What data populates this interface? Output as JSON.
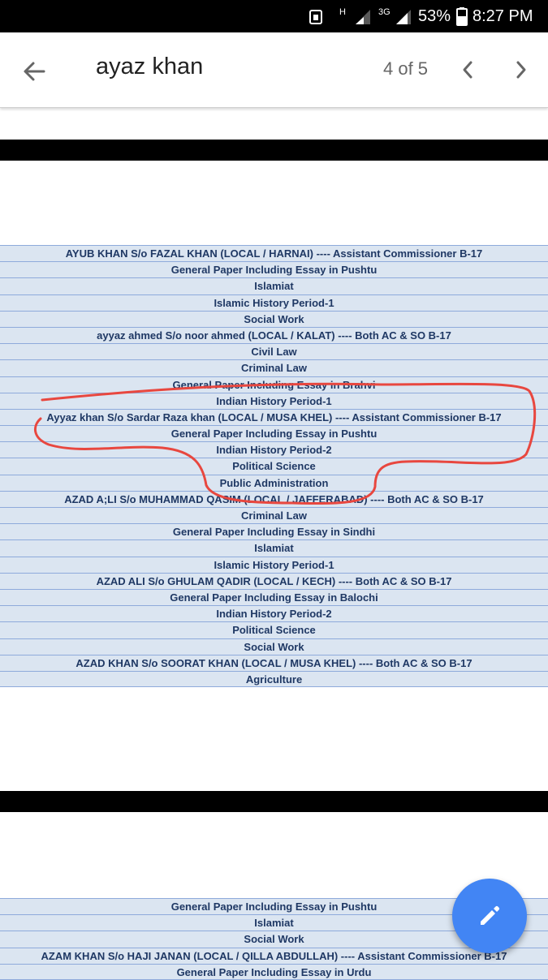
{
  "status_bar": {
    "network_h": "H",
    "network_3g": "3G",
    "battery": "53%",
    "time": "8:27 PM",
    "background_color": "#000000"
  },
  "search": {
    "query": "ayaz khan",
    "counter": "4 of 5",
    "icons": [
      "arrow-back-icon",
      "chevron-left-icon",
      "chevron-right-icon"
    ]
  },
  "page1": {
    "rows": [
      "AYUB KHAN S/o FAZAL KHAN (LOCAL / HARNAI) ---- Assistant Commissioner B-17",
      "General Paper Including Essay in Pushtu",
      "Islamiat",
      "Islamic History Period-1",
      "Social Work",
      "ayyaz ahmed S/o noor ahmed (LOCAL / KALAT) ---- Both AC & SO B-17",
      "Civil Law",
      "Criminal Law",
      "General Paper Including Essay in Brahvi",
      "Indian History Period-1",
      "Ayyaz khan S/o Sardar Raza khan (LOCAL / MUSA KHEL) ---- Assistant Commissioner B-17",
      "General Paper Including Essay in Pushtu",
      "Indian History Period-2",
      "Political Science",
      "Public Administration",
      "AZAD A;LI S/o MUHAMMAD QASIM (LOCAL / JAFFERABAD) ---- Both AC & SO B-17",
      "Criminal Law",
      "General Paper Including Essay in Sindhi",
      "Islamiat",
      "Islamic History Period-1",
      "AZAD ALI S/o GHULAM QADIR (LOCAL / KECH) ---- Both AC & SO B-17",
      "General Paper Including Essay in Balochi",
      "Indian History Period-2",
      "Political Science",
      "Social Work",
      "AZAD KHAN S/o SOORAT KHAN (LOCAL / MUSA KHEL) ---- Both AC & SO B-17",
      "Agriculture"
    ]
  },
  "page2": {
    "rows": [
      "General Paper Including Essay in Pushtu",
      "Islamiat",
      "Social Work",
      "AZAM KHAN S/o HAJI JANAN (LOCAL / QILLA ABDULLAH) ---- Assistant Commissioner B-17",
      "General Paper Including Essay in Urdu"
    ]
  },
  "colors": {
    "table_fill": "#dbe5f1",
    "table_text": "#1f3864",
    "table_rule": "#8eaadb",
    "annotation_stroke": "#e8473f",
    "fab": "#4285f4"
  },
  "fab": {
    "icon": "pencil-icon"
  }
}
